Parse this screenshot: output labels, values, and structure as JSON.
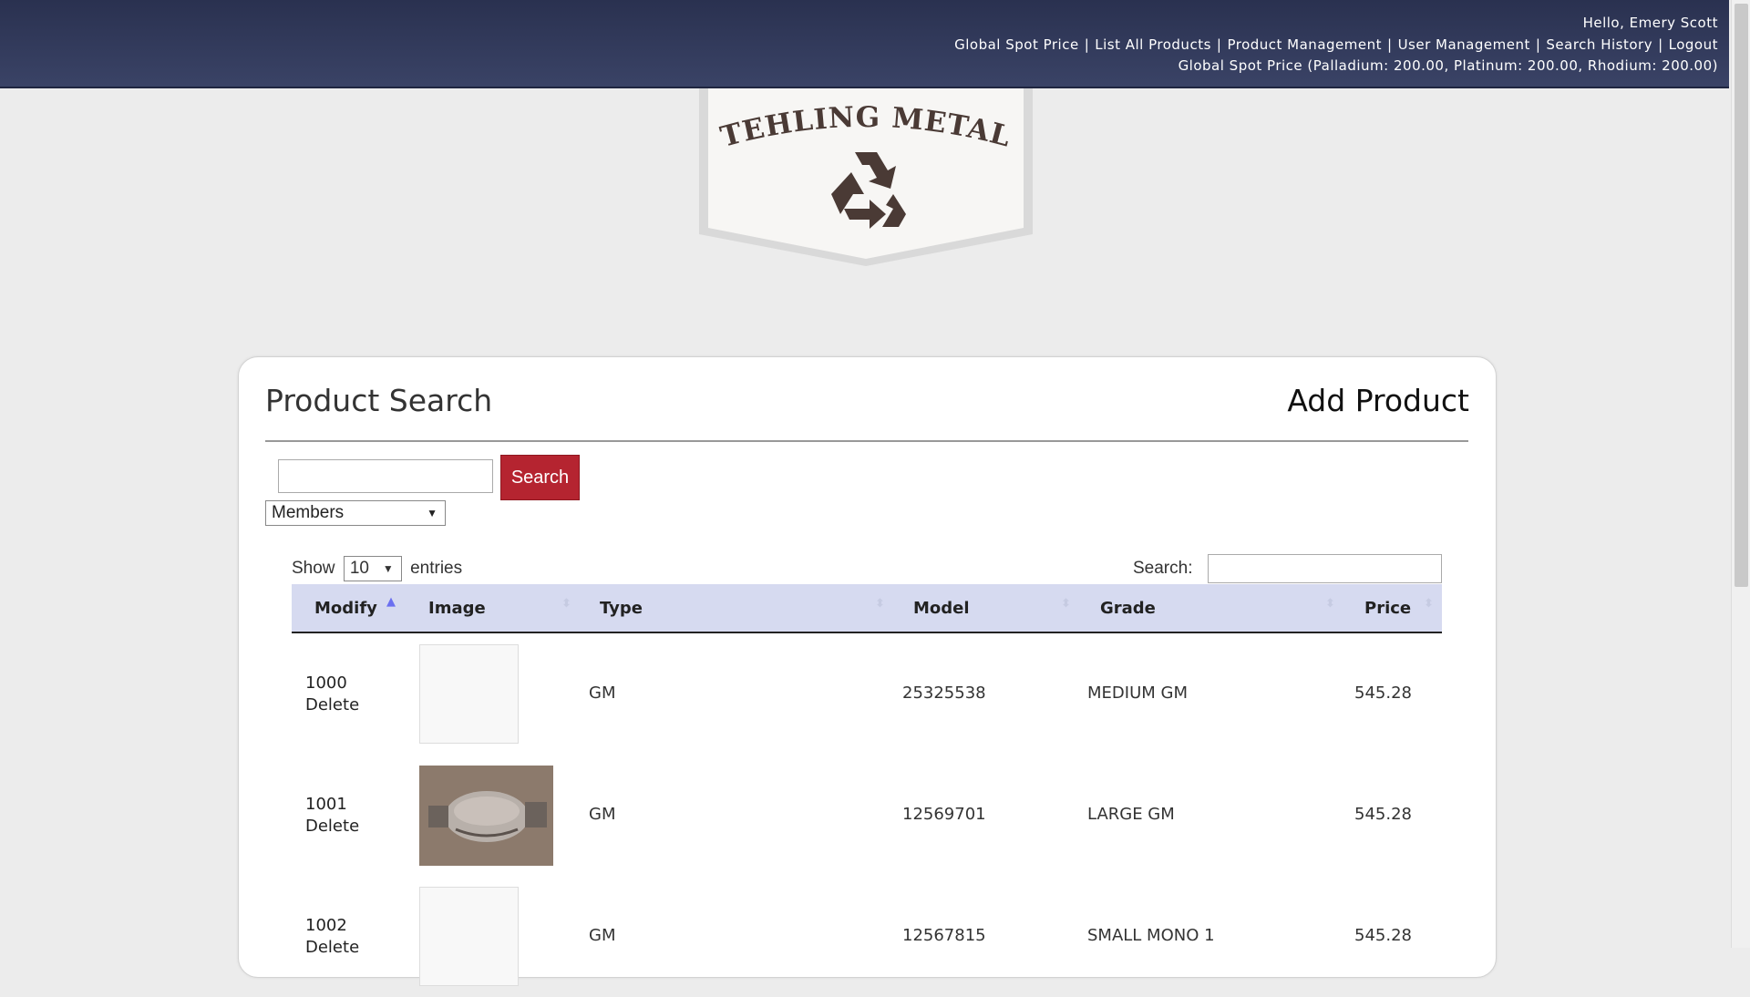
{
  "header": {
    "greeting": "Hello, Emery Scott",
    "nav": [
      "Global Spot Price",
      "List All Products",
      "Product Management",
      "User Management",
      "Search History",
      "Logout"
    ],
    "nav_separator": "|",
    "spot_price": "Global Spot Price (Palladium: 200.00, Platinum: 200.00, Rhodium: 200.00)"
  },
  "logo": {
    "text": "STEHLING METALS",
    "icon": "recycle-icon",
    "text_color": "#4a3a35"
  },
  "panel": {
    "title": "Product Search",
    "add_label": "Add Product",
    "search_button": "Search",
    "filter_select": "Members",
    "show_label": "Show",
    "entries_value": "10",
    "entries_label": "entries",
    "search_label": "Search:"
  },
  "table": {
    "columns": [
      "Modify",
      "Image",
      "Type",
      "Model",
      "Grade",
      "Price"
    ],
    "delete_label": "Delete",
    "rows": [
      {
        "id": "1000",
        "has_image": false,
        "type": "GM",
        "model": "25325538",
        "grade": "MEDIUM GM",
        "price": "545.28"
      },
      {
        "id": "1001",
        "has_image": true,
        "type": "GM",
        "model": "12569701",
        "grade": "LARGE GM",
        "price": "545.28"
      },
      {
        "id": "1002",
        "has_image": false,
        "type": "GM",
        "model": "12567815",
        "grade": "SMALL MONO 1",
        "price": "545.28"
      }
    ]
  },
  "colors": {
    "header_bg": "#2a3150",
    "search_button": "#b52430",
    "table_header": "#d6daf0"
  }
}
